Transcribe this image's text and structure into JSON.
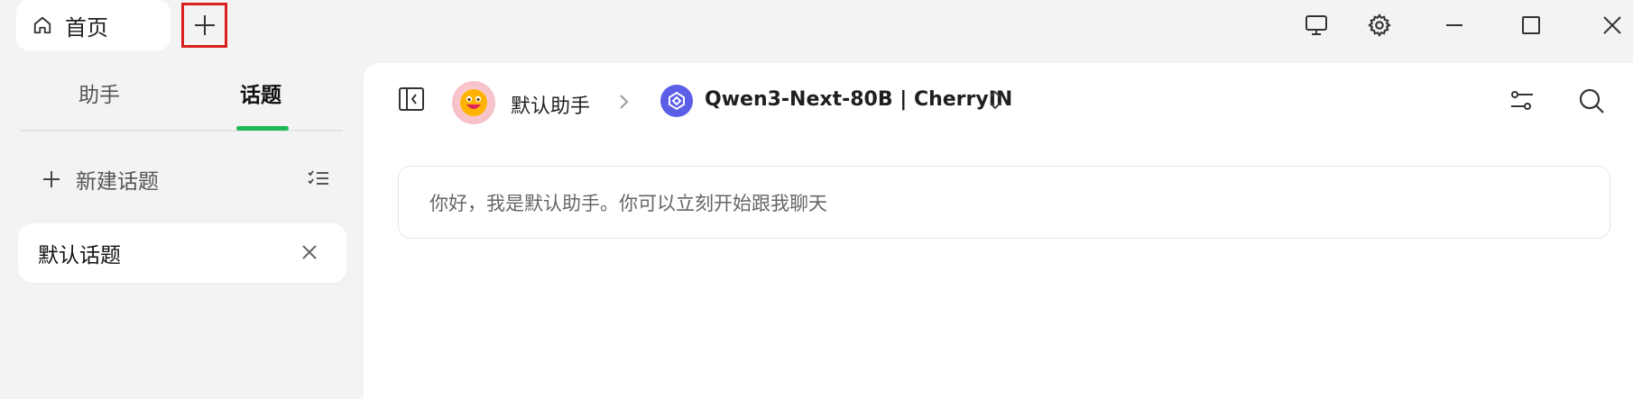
{
  "titlebar": {
    "home_tab_label": "首页",
    "home_icon": "home-icon",
    "add_tab_icon": "plus-icon",
    "window_controls": [
      "monitor-icon",
      "gear-icon",
      "minimize-icon",
      "maximize-icon",
      "close-icon"
    ]
  },
  "sidebar": {
    "tabs": [
      {
        "label": "助手",
        "active": false
      },
      {
        "label": "话题",
        "active": true
      }
    ],
    "new_topic_label": "新建话题",
    "topics": [
      {
        "label": "默认话题"
      }
    ]
  },
  "header": {
    "assistant_name": "默认助手",
    "model_name": "Qwen3-Next-80B | CherryIN"
  },
  "chat": {
    "greeting": "你好，我是默认助手。你可以立刻开始跟我聊天"
  },
  "colors": {
    "accent_green": "#1db954",
    "highlight_red": "#d9201f",
    "model_badge": "#5b5ee7"
  }
}
